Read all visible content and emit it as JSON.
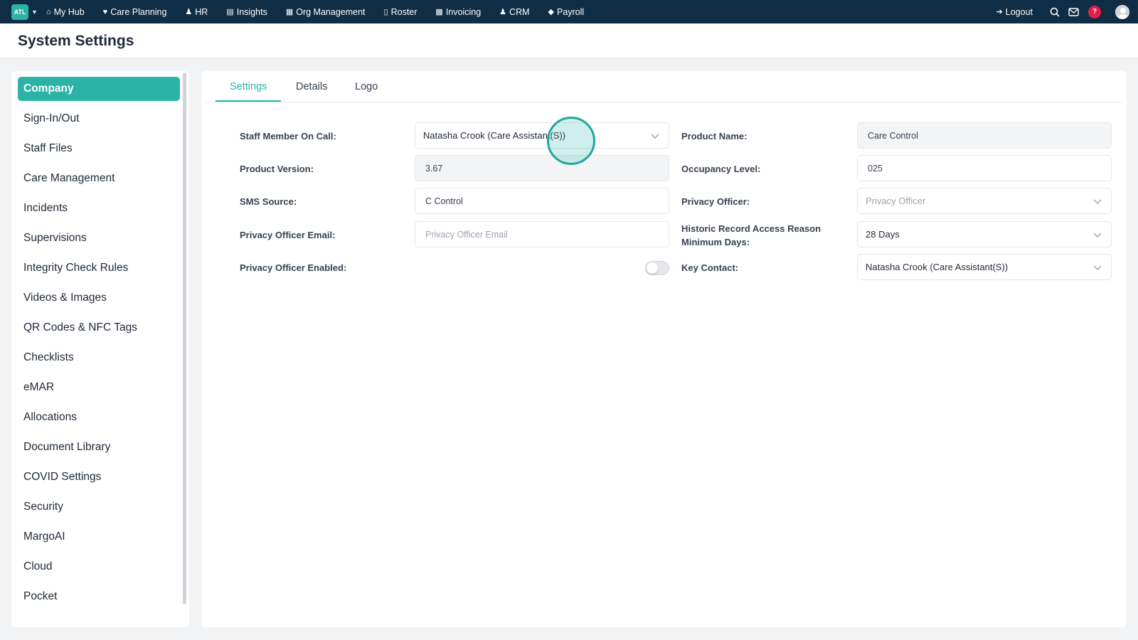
{
  "topnav": {
    "logo_text": "ATL",
    "items": [
      {
        "label": "My Hub",
        "icon": "home-icon"
      },
      {
        "label": "Care Planning",
        "icon": "heart-icon"
      },
      {
        "label": "HR",
        "icon": "people-icon"
      },
      {
        "label": "Insights",
        "icon": "chart-icon"
      },
      {
        "label": "Org Management",
        "icon": "building-icon"
      },
      {
        "label": "Roster",
        "icon": "calendar-icon"
      },
      {
        "label": "Invoicing",
        "icon": "document-icon"
      },
      {
        "label": "CRM",
        "icon": "contacts-icon"
      },
      {
        "label": "Payroll",
        "icon": "tag-icon"
      }
    ],
    "logout_label": "Logout",
    "help_label": "?"
  },
  "page": {
    "title": "System Settings"
  },
  "sidebar": {
    "items": [
      {
        "label": "Company"
      },
      {
        "label": "Sign-In/Out"
      },
      {
        "label": "Staff Files"
      },
      {
        "label": "Care Management"
      },
      {
        "label": "Incidents"
      },
      {
        "label": "Supervisions"
      },
      {
        "label": "Integrity Check Rules"
      },
      {
        "label": "Videos & Images"
      },
      {
        "label": "QR Codes & NFC Tags"
      },
      {
        "label": "Checklists"
      },
      {
        "label": "eMAR"
      },
      {
        "label": "Allocations"
      },
      {
        "label": "Document Library"
      },
      {
        "label": "COVID Settings"
      },
      {
        "label": "Security"
      },
      {
        "label": "MargoAI"
      },
      {
        "label": "Cloud"
      },
      {
        "label": "Pocket"
      }
    ],
    "active": "Company"
  },
  "tabs": [
    {
      "label": "Settings"
    },
    {
      "label": "Details"
    },
    {
      "label": "Logo"
    }
  ],
  "form": {
    "staff_on_call": {
      "label": "Staff Member On Call:",
      "value": "Natasha Crook (Care Assistant(S))"
    },
    "product_version": {
      "label": "Product Version:",
      "value": "3.67"
    },
    "sms_source": {
      "label": "SMS Source:",
      "value": "C Control"
    },
    "privacy_officer_email": {
      "label": "Privacy Officer Email:",
      "placeholder": "Privacy Officer Email",
      "value": ""
    },
    "privacy_officer_enabled": {
      "label": "Privacy Officer Enabled:",
      "enabled": false
    },
    "product_name": {
      "label": "Product Name:",
      "value": "Care Control"
    },
    "occupancy_level": {
      "label": "Occupancy Level:",
      "value": "025"
    },
    "privacy_officer": {
      "label": "Privacy Officer:",
      "placeholder": "Privacy Officer"
    },
    "historic_access_days": {
      "label_line1": "Historic Record Access Reason",
      "label_line2": "Minimum Days:",
      "value": "28 Days"
    },
    "key_contact": {
      "label": "Key Contact:",
      "value": "Natasha Crook (Care Assistant(S))"
    }
  },
  "colors": {
    "nav_bg": "#0f2d44",
    "accent": "#2bb3a6",
    "help_badge": "#e11d48"
  }
}
